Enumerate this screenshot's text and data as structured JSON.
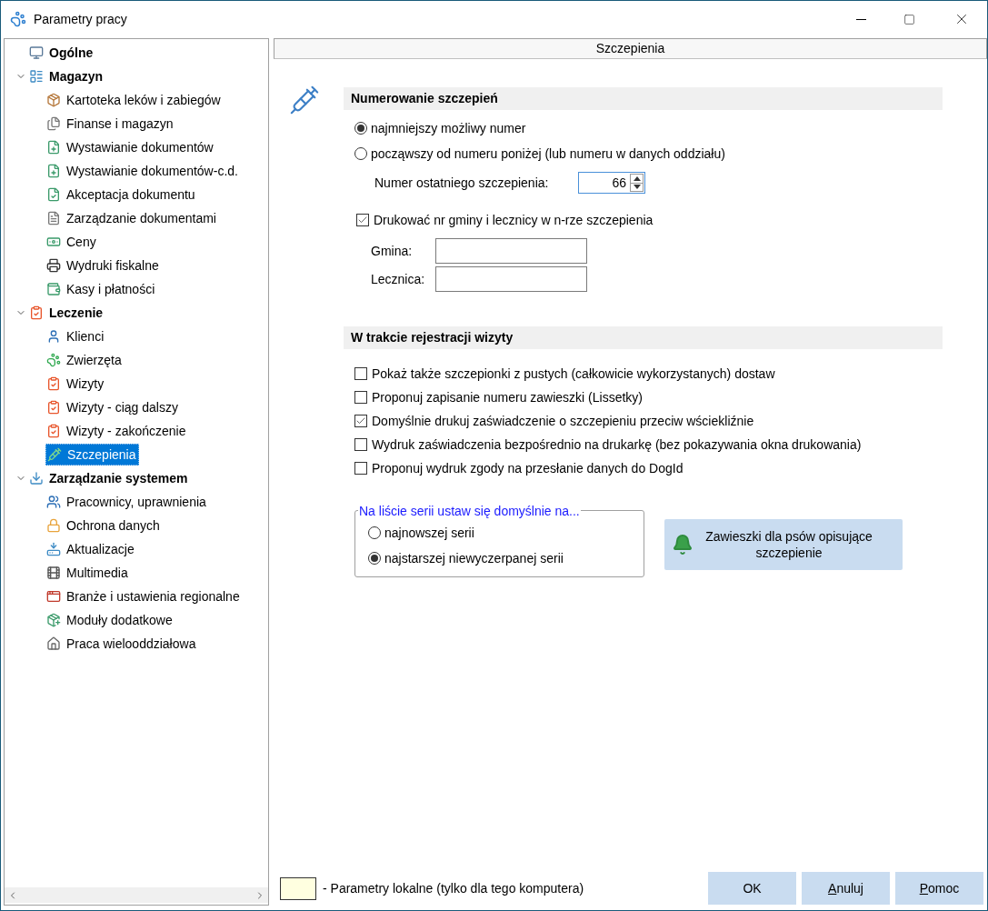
{
  "window": {
    "title": "Parametry pracy"
  },
  "tree": [
    {
      "label": "Ogólne",
      "selected": false
    },
    {
      "label": "Magazyn",
      "selected": false,
      "expanded": true,
      "children": [
        {
          "label": "Kartoteka leków i zabiegów",
          "selected": false
        },
        {
          "label": "Finanse i magazyn",
          "selected": false
        },
        {
          "label": "Wystawianie dokumentów",
          "selected": false
        },
        {
          "label": "Wystawianie dokumentów-c.d.",
          "selected": false
        },
        {
          "label": "Akceptacja dokumentu",
          "selected": false
        },
        {
          "label": "Zarządzanie dokumentami",
          "selected": false
        },
        {
          "label": "Ceny",
          "selected": false
        },
        {
          "label": "Wydruki fiskalne",
          "selected": false
        },
        {
          "label": "Kasy i płatności",
          "selected": false
        }
      ]
    },
    {
      "label": "Leczenie",
      "selected": false,
      "expanded": true,
      "children": [
        {
          "label": "Klienci",
          "selected": false
        },
        {
          "label": "Zwierzęta",
          "selected": false
        },
        {
          "label": "Wizyty",
          "selected": false
        },
        {
          "label": "Wizyty - ciąg dalszy",
          "selected": false
        },
        {
          "label": "Wizyty - zakończenie",
          "selected": false
        },
        {
          "label": "Szczepienia",
          "selected": true
        }
      ]
    },
    {
      "label": "Zarządzanie systemem",
      "selected": false,
      "expanded": true,
      "children": [
        {
          "label": "Pracownicy, uprawnienia",
          "selected": false
        },
        {
          "label": "Ochrona danych",
          "selected": false
        },
        {
          "label": "Aktualizacje",
          "selected": false
        },
        {
          "label": "Multimedia",
          "selected": false
        },
        {
          "label": "Branże i ustawienia regionalne",
          "selected": false
        },
        {
          "label": "Moduły dodatkowe",
          "selected": false
        },
        {
          "label": "Praca wielooddziałowa",
          "selected": false
        }
      ]
    }
  ],
  "panel_title": "Szczepienia",
  "numbering": {
    "title": "Numerowanie szczepień",
    "options": [
      {
        "label": "najmniejszy możliwy numer",
        "selected": true
      },
      {
        "label": "począwszy od numeru poniżej (lub numeru w danych oddziału)",
        "selected": false
      }
    ],
    "last_number": {
      "label": "Numer ostatniego szczepienia:",
      "value": "66"
    },
    "print_codes": {
      "label": "Drukować nr gminy i lecznicy w n-rze szczepienia",
      "checked": true
    },
    "gmina": {
      "label": "Gmina:"
    },
    "lecznica": {
      "label": "Lecznica:"
    }
  },
  "visit": {
    "title": "W trakcie rejestracji wizyty",
    "checkboxes": [
      {
        "label": "Pokaż także szczepionki z pustych (całkowicie wykorzystanych) dostaw",
        "checked": false
      },
      {
        "label": "Proponuj zapisanie numeru zawieszki (Lissetky)",
        "checked": false
      },
      {
        "label": "Domyślnie drukuj zaświadczenie o szczepieniu przeciw wściekliźnie",
        "checked": true
      },
      {
        "label": "Wydruk zaświadczenia bezpośrednio na drukarkę (bez pokazywania okna drukowania)",
        "checked": false
      },
      {
        "label": "Proponuj wydruk zgody na przesłanie danych do DogId",
        "checked": false
      }
    ],
    "series_group": {
      "legend": "Na liście serii ustaw się domyślnie na...",
      "options": [
        {
          "label": "najnowszej serii",
          "selected": false
        },
        {
          "label": "najstarszej niewyczerpanej serii",
          "selected": true
        }
      ]
    },
    "tags_button": {
      "label": "Zawieszki dla psów opisujące szczepienie"
    }
  },
  "legend": {
    "label": "- Parametry lokalne (tylko dla tego komputera)"
  },
  "buttons": [
    {
      "label": "OK",
      "underline_first": false
    },
    {
      "label": "Anuluj",
      "underline_first": true
    },
    {
      "label": "Pomoc",
      "underline_first": true
    }
  ]
}
